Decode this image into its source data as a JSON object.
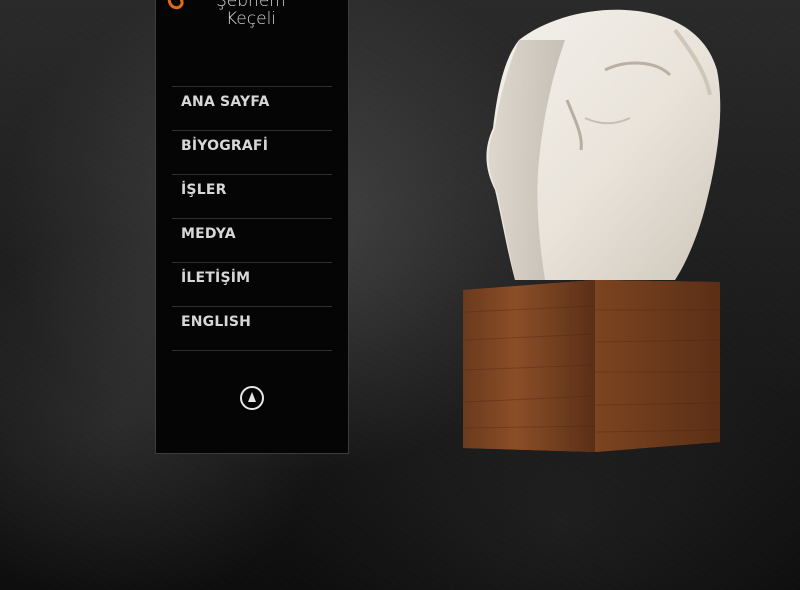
{
  "logo": {
    "line1": "Şebnem",
    "line2": "Keçeli",
    "accent": "#e26a17"
  },
  "nav": {
    "items": [
      {
        "label": "ANA SAYFA"
      },
      {
        "label": "BİYOGRAFİ"
      },
      {
        "label": "İŞLER"
      },
      {
        "label": "MEDYA"
      },
      {
        "label": "İLETİŞİM"
      },
      {
        "label": "ENGLISH"
      }
    ]
  },
  "icons": {
    "scroll_top": "compass-arrow-icon"
  }
}
